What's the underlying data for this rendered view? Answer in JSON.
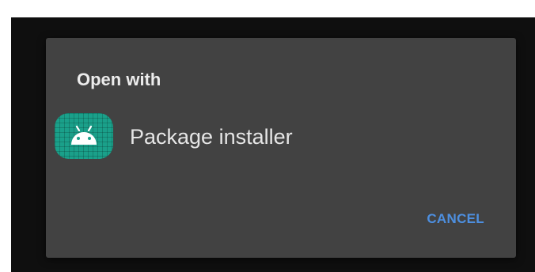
{
  "dialog": {
    "title": "Open with",
    "apps": [
      {
        "label": "Package installer",
        "icon": "android-icon",
        "icon_color": "#1aa08a"
      }
    ],
    "cancel_label": "CANCEL",
    "accent_color": "#4d8fe0",
    "background_color": "#424242"
  }
}
